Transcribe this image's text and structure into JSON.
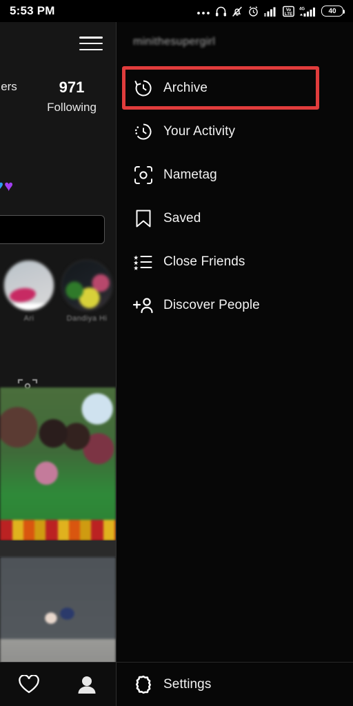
{
  "status_bar": {
    "time": "5:53 PM",
    "battery_level": "40",
    "icons": [
      "ellipsis-icon",
      "headphones-icon",
      "bell-muted-icon",
      "alarm-clock-icon",
      "signal-bars-icon",
      "volte-icon",
      "signal-4g-icon",
      "battery-icon"
    ],
    "volte_top": "Vo",
    "volte_bottom": "LTE",
    "network_label": "4G"
  },
  "profile": {
    "menu_icon": "hamburger-icon",
    "stats": [
      {
        "number": "",
        "label": "ers"
      },
      {
        "number": "971",
        "label": "Following"
      }
    ],
    "bio_emoji_blue": "♥",
    "bio_emoji_purple": "♥",
    "edit_profile_label": "",
    "highlights": [
      {
        "label": "Ari"
      },
      {
        "label": "Dandiya Hi"
      }
    ],
    "tabs": [
      {
        "name": "tagged-tab",
        "label": ""
      }
    ],
    "grid_badge": "carousel-icon",
    "bottom_nav": [
      {
        "name": "activity-tab",
        "icon": "heart-icon"
      },
      {
        "name": "profile-tab",
        "icon": "person-icon"
      }
    ]
  },
  "drawer": {
    "username": "minithesupergirl",
    "items": [
      {
        "label": "Archive",
        "icon": "archive-clock-icon",
        "highlighted": true
      },
      {
        "label": "Your Activity",
        "icon": "activity-clock-icon",
        "highlighted": false
      },
      {
        "label": "Nametag",
        "icon": "nametag-icon",
        "highlighted": false
      },
      {
        "label": "Saved",
        "icon": "bookmark-icon",
        "highlighted": false
      },
      {
        "label": "Close Friends",
        "icon": "star-list-icon",
        "highlighted": false
      },
      {
        "label": "Discover People",
        "icon": "person-add-icon",
        "highlighted": false
      }
    ],
    "footer": {
      "label": "Settings",
      "icon": "gear-icon"
    }
  },
  "colors": {
    "highlight_red": "#e03c3c",
    "drawer_bg": "#070707",
    "profile_bg": "#161616",
    "text_primary": "#f2f2f2",
    "text_muted": "#a9a9a9",
    "heart_blue": "#2d9bf0",
    "heart_purple": "#a13ef0"
  }
}
